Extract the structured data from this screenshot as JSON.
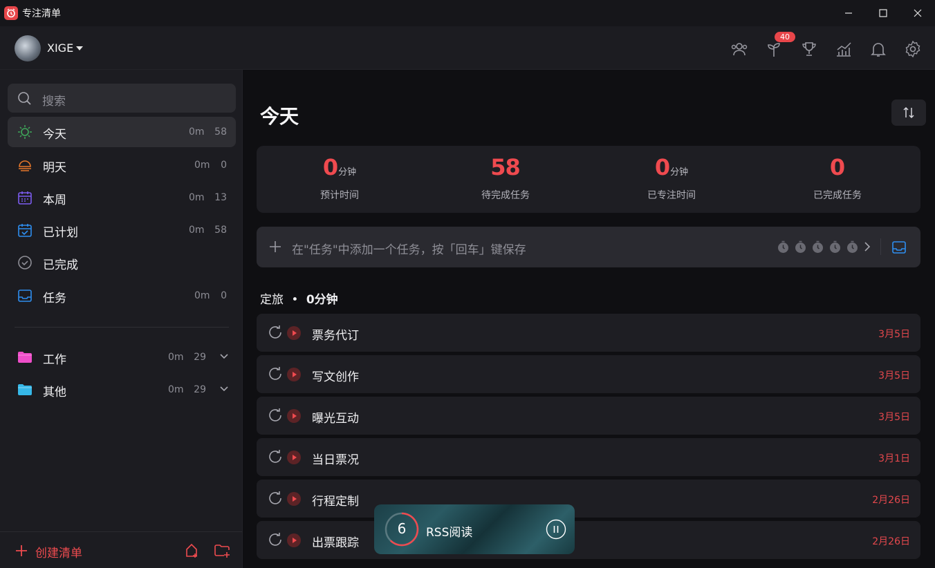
{
  "window": {
    "title": "专注清单"
  },
  "header": {
    "username": "XIGE",
    "badge_count": "40",
    "icons": [
      "team-icon",
      "sprout-icon",
      "trophy-icon",
      "stats-icon",
      "bell-icon",
      "gear-icon"
    ]
  },
  "sidebar": {
    "search_placeholder": "搜索",
    "items": [
      {
        "label": "今天",
        "min": "0m",
        "count": "58"
      },
      {
        "label": "明天",
        "min": "0m",
        "count": "0"
      },
      {
        "label": "本周",
        "min": "0m",
        "count": "13"
      },
      {
        "label": "已计划",
        "min": "0m",
        "count": "58"
      },
      {
        "label": "已完成"
      },
      {
        "label": "任务",
        "min": "0m",
        "count": "0"
      }
    ],
    "folders": [
      {
        "label": "工作",
        "min": "0m",
        "count": "29"
      },
      {
        "label": "其他",
        "min": "0m",
        "count": "29"
      }
    ],
    "create_label": "创建清单"
  },
  "main": {
    "title": "今天",
    "stats": [
      {
        "value": "0",
        "unit": "分钟",
        "label": "预计时间"
      },
      {
        "value": "58",
        "unit": "",
        "label": "待完成任务"
      },
      {
        "value": "0",
        "unit": "分钟",
        "label": "已专注时间"
      },
      {
        "value": "0",
        "unit": "",
        "label": "已完成任务"
      }
    ],
    "add_placeholder": "在\"任务\"中添加一个任务，按「回车」键保存",
    "section": {
      "name": "定旅",
      "sep": "•",
      "time": "0分钟"
    },
    "tasks": [
      {
        "name": "票务代订",
        "date": "3月5日"
      },
      {
        "name": "写文创作",
        "date": "3月5日"
      },
      {
        "name": "曝光互动",
        "date": "3月5日"
      },
      {
        "name": "当日票况",
        "date": "3月1日"
      },
      {
        "name": "行程定制",
        "date": "2月26日"
      },
      {
        "name": "出票跟踪",
        "date": "2月26日"
      }
    ]
  },
  "mini_player": {
    "count": "6",
    "title": "RSS阅读"
  },
  "colors": {
    "accent": "#ef4a4f",
    "bg": "#0f0f12",
    "panel": "#1c1c21"
  }
}
